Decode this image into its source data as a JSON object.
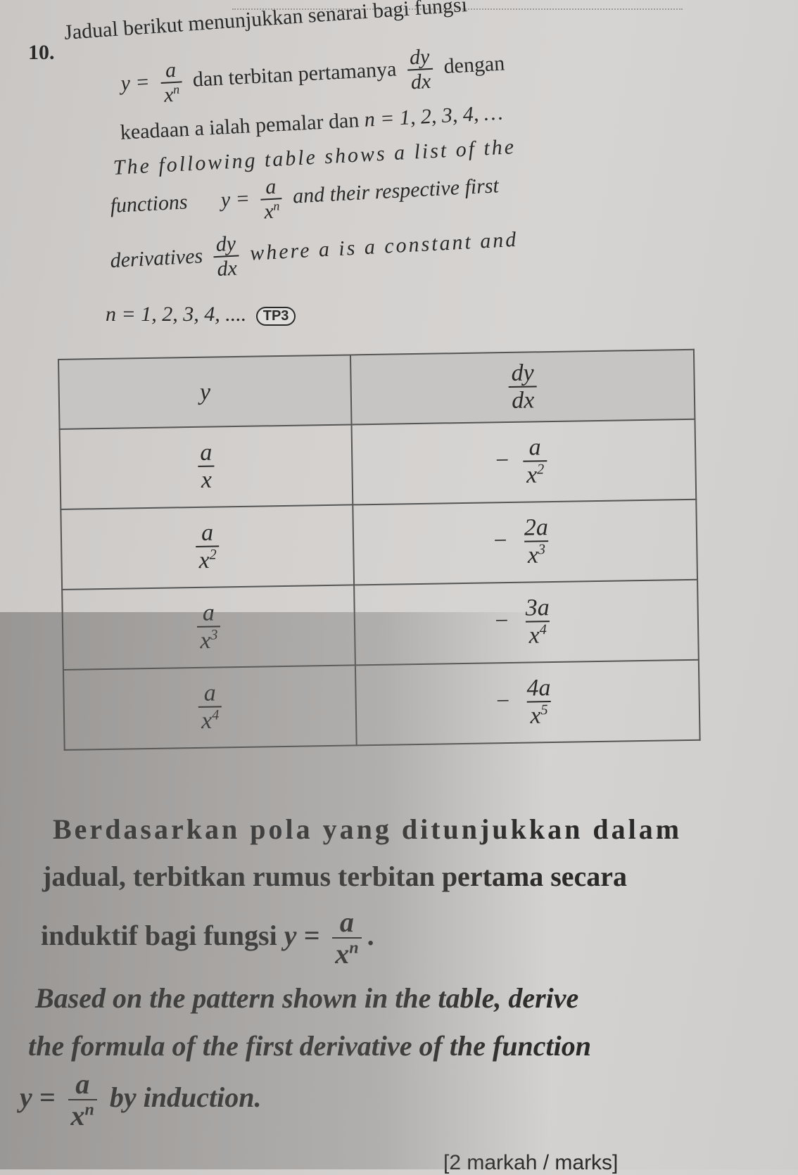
{
  "question": {
    "number": "10.",
    "malay_intro": {
      "line1": "Jadual berikut menunjukkan senarai bagi fungsi",
      "y_eq": "y =",
      "frac_num": "a",
      "frac_den_base": "x",
      "frac_den_exp": "n",
      "mid_text": "dan terbitan pertamanya",
      "dy": "dy",
      "dx": "dx",
      "dengan": "dengan",
      "line3": "keadaan a ialah pemalar dan",
      "n_values": "n = 1, 2, 3, 4, …"
    },
    "english_intro": {
      "line1": "The following table shows a list of the",
      "functions": "functions",
      "y_eq": "y =",
      "frac_num": "a",
      "frac_den_base": "x",
      "frac_den_exp": "n",
      "line2_tail": "and their respective first",
      "derivatives": "derivatives",
      "dy": "dy",
      "dx": "dx",
      "line3_tail": "where a is a constant and",
      "n_values": "n = 1, 2, 3, 4, ....",
      "badge": "TP3"
    },
    "table": {
      "headers": {
        "y": "y",
        "dydx_num": "dy",
        "dydx_den": "dx"
      },
      "rows": [
        {
          "y_num": "a",
          "y_den": "x",
          "y_exp": "",
          "d_sign": "−",
          "d_num": "a",
          "d_den": "x",
          "d_exp": "2"
        },
        {
          "y_num": "a",
          "y_den": "x",
          "y_exp": "2",
          "d_sign": "−",
          "d_num": "2a",
          "d_den": "x",
          "d_exp": "3"
        },
        {
          "y_num": "a",
          "y_den": "x",
          "y_exp": "3",
          "d_sign": "−",
          "d_num": "3a",
          "d_den": "x",
          "d_exp": "4"
        },
        {
          "y_num": "a",
          "y_den": "x",
          "y_exp": "4",
          "d_sign": "−",
          "d_num": "4a",
          "d_den": "x",
          "d_exp": "5"
        }
      ]
    },
    "malay_task": {
      "line1": "Berdasarkan pola yang ditunjukkan dalam",
      "line2": "jadual, terbitkan rumus terbitan pertama secara",
      "line3": "induktif bagi fungsi",
      "y_eq": "y =",
      "frac_num": "a",
      "frac_den_base": "x",
      "frac_den_exp": "n",
      "end": "."
    },
    "english_task": {
      "line1": "Based on the pattern shown in the table, derive",
      "line2": "the formula of the first derivative of the function",
      "y_eq": "y =",
      "frac_num": "a",
      "frac_den_base": "x",
      "frac_den_exp": "n",
      "tail": "by induction."
    },
    "marks": "[2 markah / marks]"
  }
}
